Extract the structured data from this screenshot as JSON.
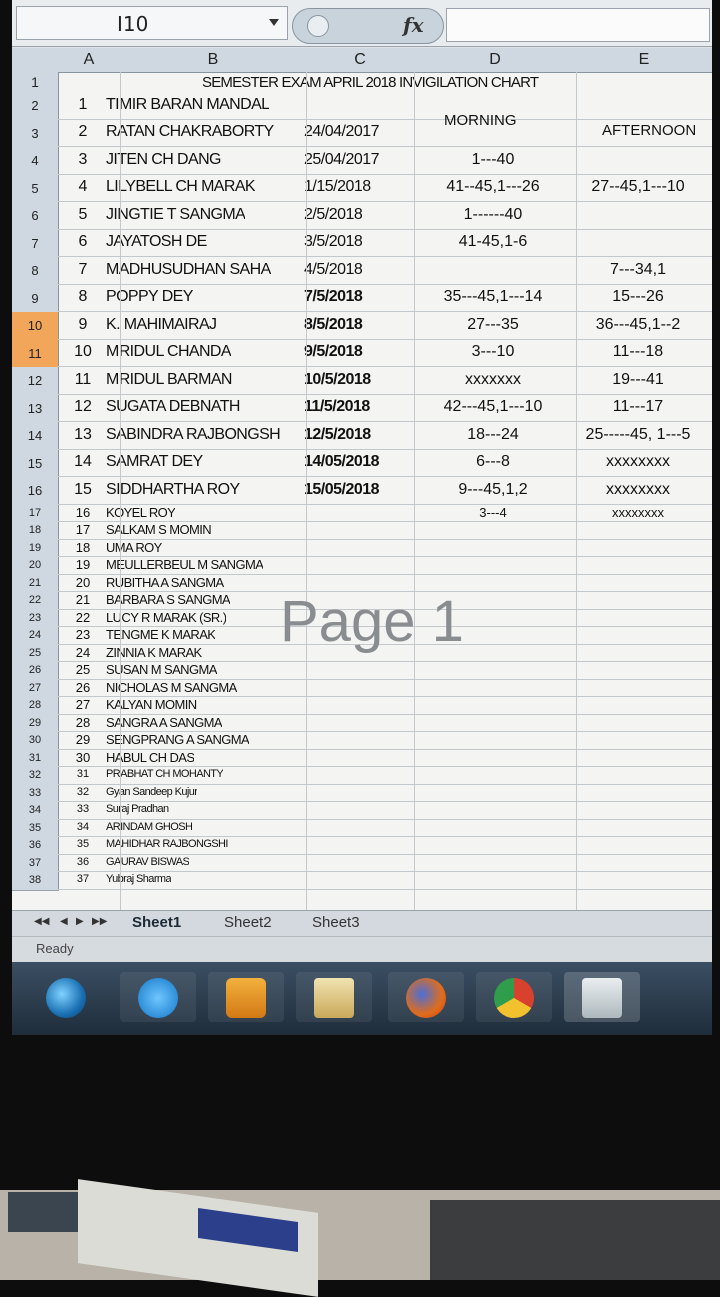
{
  "formula_bar": {
    "name_box": "I10",
    "fx_label": "fx"
  },
  "columns": [
    "A",
    "B",
    "C",
    "D",
    "E"
  ],
  "selected_rows": [
    "10",
    "11"
  ],
  "title_row": {
    "row_label": "1",
    "title": "SEMESTER EXAM APRIL 2018 INVIGILATION CHART",
    "morning_label": "MORNING",
    "afternoon_label": "AFTERNOON"
  },
  "rows": [
    {
      "r": "2",
      "n": "1",
      "name": "TIMIR BARAN MANDAL",
      "date": "",
      "morning": "",
      "afternoon": ""
    },
    {
      "r": "3",
      "n": "2",
      "name": "RATAN CHAKRABORTY",
      "date": "24/04/2017",
      "morning": "",
      "afternoon": ""
    },
    {
      "r": "4",
      "n": "3",
      "name": "JITEN CH DANG",
      "date": "25/04/2017",
      "morning": "1---40",
      "afternoon": ""
    },
    {
      "r": "5",
      "n": "4",
      "name": "LILYBELL CH MARAK",
      "date": "1/15/2018",
      "morning": "41--45,1---26",
      "afternoon": "27--45,1---10"
    },
    {
      "r": "6",
      "n": "5",
      "name": "JINGTIE T SANGMA",
      "date": "2/5/2018",
      "morning": "1------40",
      "afternoon": ""
    },
    {
      "r": "7",
      "n": "6",
      "name": "JAYATOSH DE",
      "date": "3/5/2018",
      "morning": "41-45,1-6",
      "afternoon": ""
    },
    {
      "r": "8",
      "n": "7",
      "name": "MADHUSUDHAN SAHA",
      "date": "4/5/2018",
      "morning": "",
      "afternoon": "7---34,1"
    },
    {
      "r": "9",
      "n": "8",
      "name": "POPPY DEY",
      "date": "7/5/2018",
      "morning": "35---45,1---14",
      "afternoon": "15---26"
    },
    {
      "r": "10",
      "n": "9",
      "name": "K. MAHIMAIRAJ",
      "date": "8/5/2018",
      "morning": "27---35",
      "afternoon": "36---45,1--2"
    },
    {
      "r": "11",
      "n": "10",
      "name": "MRIDUL CHANDA",
      "date": "9/5/2018",
      "morning": "3---10",
      "afternoon": "11---18"
    },
    {
      "r": "12",
      "n": "11",
      "name": "MRIDUL BARMAN",
      "date": "10/5/2018",
      "morning": "xxxxxxx",
      "afternoon": "19---41"
    },
    {
      "r": "13",
      "n": "12",
      "name": "SUGATA DEBNATH",
      "date": "11/5/2018",
      "morning": "42---45,1---10",
      "afternoon": "11---17"
    },
    {
      "r": "14",
      "n": "13",
      "name": "SABINDRA RAJBONGSH",
      "date": "12/5/2018",
      "morning": "18---24",
      "afternoon": "25-----45, 1---5"
    },
    {
      "r": "15",
      "n": "14",
      "name": "SAMRAT DEY",
      "date": "14/05/2018",
      "morning": "6---8",
      "afternoon": "xxxxxxxx"
    },
    {
      "r": "16",
      "n": "15",
      "name": "SIDDHARTHA ROY",
      "date": "15/05/2018",
      "morning": "9---45,1,2",
      "afternoon": "xxxxxxxx"
    },
    {
      "r": "17",
      "n": "16",
      "name": "KOYEL ROY",
      "date": "",
      "morning": "3---4",
      "afternoon": "xxxxxxxx"
    },
    {
      "r": "18",
      "n": "17",
      "name": "SALKAM S MOMIN",
      "date": "",
      "morning": "",
      "afternoon": ""
    },
    {
      "r": "19",
      "n": "18",
      "name": "UMA ROY",
      "date": "",
      "morning": "",
      "afternoon": ""
    },
    {
      "r": "20",
      "n": "19",
      "name": "MEULLERBEUL M SANGMA",
      "date": "",
      "morning": "",
      "afternoon": ""
    },
    {
      "r": "21",
      "n": "20",
      "name": "RUBITHA A SANGMA",
      "date": "",
      "morning": "",
      "afternoon": ""
    },
    {
      "r": "22",
      "n": "21",
      "name": "BARBARA S SANGMA",
      "date": "",
      "morning": "",
      "afternoon": ""
    },
    {
      "r": "23",
      "n": "22",
      "name": "LUCY R MARAK (SR.)",
      "date": "",
      "morning": "",
      "afternoon": ""
    },
    {
      "r": "24",
      "n": "23",
      "name": "TENGME K MARAK",
      "date": "",
      "morning": "",
      "afternoon": ""
    },
    {
      "r": "25",
      "n": "24",
      "name": "ZINNIA K MARAK",
      "date": "",
      "morning": "",
      "afternoon": ""
    },
    {
      "r": "26",
      "n": "25",
      "name": "SUSAN M SANGMA",
      "date": "",
      "morning": "",
      "afternoon": ""
    },
    {
      "r": "27",
      "n": "26",
      "name": "NICHOLAS M SANGMA",
      "date": "",
      "morning": "",
      "afternoon": ""
    },
    {
      "r": "28",
      "n": "27",
      "name": "KALYAN MOMIN",
      "date": "",
      "morning": "",
      "afternoon": ""
    },
    {
      "r": "29",
      "n": "28",
      "name": "SANGRA A SANGMA",
      "date": "",
      "morning": "",
      "afternoon": ""
    },
    {
      "r": "30",
      "n": "29",
      "name": "SENGPRANG A SANGMA",
      "date": "",
      "morning": "",
      "afternoon": ""
    },
    {
      "r": "31",
      "n": "30",
      "name": "HABUL CH DAS",
      "date": "",
      "morning": "",
      "afternoon": ""
    },
    {
      "r": "32",
      "n": "31",
      "name": "PRABHAT CH MOHANTY",
      "date": "",
      "morning": "",
      "afternoon": ""
    },
    {
      "r": "33",
      "n": "32",
      "name": "Gyan Sandeep Kujur",
      "date": "",
      "morning": "",
      "afternoon": ""
    },
    {
      "r": "34",
      "n": "33",
      "name": "Suraj Pradhan",
      "date": "",
      "morning": "",
      "afternoon": ""
    },
    {
      "r": "35",
      "n": "34",
      "name": "ARINDAM GHOSH",
      "date": "",
      "morning": "",
      "afternoon": ""
    },
    {
      "r": "36",
      "n": "35",
      "name": "MAHIDHAR RAJBONGSHI",
      "date": "",
      "morning": "",
      "afternoon": ""
    },
    {
      "r": "37",
      "n": "36",
      "name": "GAURAV BISWAS",
      "date": "",
      "morning": "",
      "afternoon": ""
    },
    {
      "r": "38",
      "n": "37",
      "name": "Yubraj Sharma",
      "date": "",
      "morning": "",
      "afternoon": ""
    }
  ],
  "watermark": "Page 1",
  "sheet_tabs": [
    "Sheet1",
    "Sheet2",
    "Sheet3"
  ],
  "status": "Ready",
  "taskbar": [
    "start-icon",
    "internet-explorer-icon",
    "media-player-icon",
    "file-explorer-icon",
    "firefox-icon",
    "chrome-icon",
    "excel-icon"
  ],
  "colors": {
    "selected_row_header": "#f1a65a",
    "taskbar": "#2a3a4a"
  }
}
